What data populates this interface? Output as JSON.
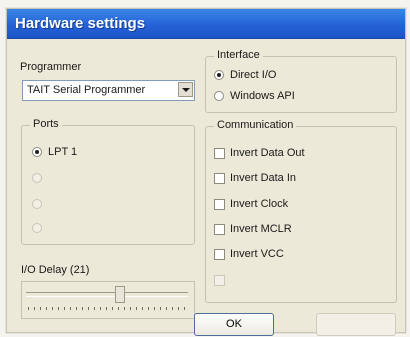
{
  "window": {
    "title": "Hardware settings"
  },
  "programmer": {
    "label": "Programmer",
    "value": "TAIT Serial Programmer"
  },
  "interface": {
    "legend": "Interface",
    "options": [
      {
        "label": "Direct I/O",
        "selected": true
      },
      {
        "label": "Windows API",
        "selected": false
      }
    ]
  },
  "ports": {
    "legend": "Ports",
    "options": [
      {
        "label": "LPT 1",
        "selected": true,
        "enabled": true
      },
      {
        "label": "",
        "selected": false,
        "enabled": false
      },
      {
        "label": "",
        "selected": false,
        "enabled": false
      },
      {
        "label": "",
        "selected": false,
        "enabled": false
      }
    ]
  },
  "communication": {
    "legend": "Communication",
    "options": [
      {
        "label": "Invert Data Out",
        "checked": false,
        "enabled": true
      },
      {
        "label": "Invert Data In",
        "checked": false,
        "enabled": true
      },
      {
        "label": "Invert Clock",
        "checked": false,
        "enabled": true
      },
      {
        "label": "Invert MCLR",
        "checked": false,
        "enabled": true
      },
      {
        "label": "Invert VCC",
        "checked": false,
        "enabled": true
      },
      {
        "label": "",
        "checked": false,
        "enabled": false
      }
    ]
  },
  "io_delay": {
    "label": "I/O Delay (21)",
    "value": 21
  },
  "buttons": {
    "ok": "OK",
    "cancel": ""
  },
  "colors": {
    "titlebar": "#2562d6",
    "face": "#ece9d8"
  }
}
